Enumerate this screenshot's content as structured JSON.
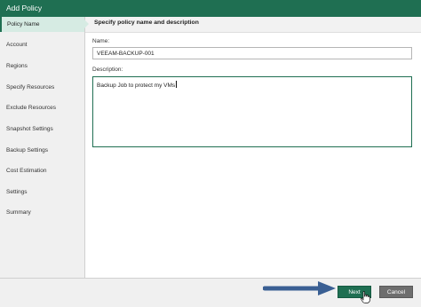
{
  "window": {
    "title": "Add Policy"
  },
  "sidebar": {
    "items": [
      {
        "label": "Policy Name",
        "active": true
      },
      {
        "label": "Account"
      },
      {
        "label": "Regions"
      },
      {
        "label": "Specify Resources"
      },
      {
        "label": "Exclude Resources"
      },
      {
        "label": "Snapshot Settings"
      },
      {
        "label": "Backup Settings"
      },
      {
        "label": "Cost Estimation"
      },
      {
        "label": "Settings"
      },
      {
        "label": "Summary"
      }
    ]
  },
  "main": {
    "header": "Specify policy name and description",
    "name_label": "Name:",
    "name_value": "VEEAM-BACKUP-001",
    "description_label": "Description:",
    "description_value": "Backup Job to protect my VMs"
  },
  "footer": {
    "next_label": "Next",
    "cancel_label": "Cancel"
  },
  "colors": {
    "accent": "#1f6f52",
    "active_item_bg": "#d6ebe3",
    "arrow": "#3a5f93"
  }
}
